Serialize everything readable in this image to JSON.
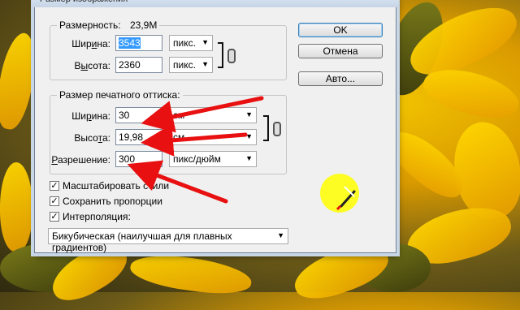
{
  "window_title": "Размер изображения",
  "pixel_dimensions": {
    "label": "Размерность:",
    "size": "23,9M",
    "width_label_pre": "Шир",
    "width_label_u": "и",
    "width_label_post": "на:",
    "width_value": "3543",
    "width_unit": "пикс.",
    "height_label_pre": "В",
    "height_label_u": "ы",
    "height_label_post": "сота:",
    "height_value": "2360",
    "height_unit": "пикс."
  },
  "document_size": {
    "title": "Размер печатного оттиска:",
    "width_label_pre": "Ши",
    "width_label_u": "р",
    "width_label_post": "ина:",
    "width_value": "30",
    "width_unit": "см",
    "height_label_pre": "Высо",
    "height_label_u": "т",
    "height_label_post": "а:",
    "height_value": "19,98",
    "height_unit": "см",
    "resolution_label_pre": "",
    "resolution_label_u": "Р",
    "resolution_label_post": "азрешение:",
    "resolution_value": "300",
    "resolution_unit": "пикс/дюйм"
  },
  "buttons": {
    "ok": "OK",
    "cancel": "Отмена",
    "auto": "Авто..."
  },
  "options": {
    "scale_styles": "Масштабировать стили",
    "constrain_proportions": "Сохранить пропорции",
    "resample": "Интерполяция:",
    "resample_method": "Бикубическая (наилучшая для плавных градиентов)"
  },
  "colors": {
    "arrow": "#e81010",
    "highlight": "#ffff00"
  }
}
